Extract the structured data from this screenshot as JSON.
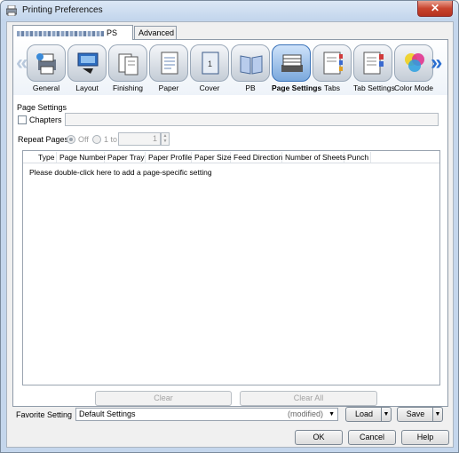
{
  "window": {
    "title": "Printing Preferences",
    "close_glyph": "✕"
  },
  "tabs": [
    {
      "label": "PS",
      "blurred_prefix": true
    },
    {
      "label": "Advanced"
    }
  ],
  "ribbon": {
    "left_arrow": "«",
    "right_arrow": "»",
    "items": [
      {
        "label": "General",
        "icon": "general-icon",
        "selected": false
      },
      {
        "label": "Layout",
        "icon": "layout-icon",
        "selected": false
      },
      {
        "label": "Finishing",
        "icon": "finishing-icon",
        "selected": false
      },
      {
        "label": "Paper",
        "icon": "paper-icon",
        "selected": false
      },
      {
        "label": "Cover",
        "icon": "cover-icon",
        "selected": false
      },
      {
        "label": "PB",
        "icon": "pb-icon",
        "selected": false
      },
      {
        "label": "Page Settings",
        "icon": "page-settings-icon",
        "selected": true
      },
      {
        "label": "Tabs",
        "icon": "tabs-icon",
        "selected": false
      },
      {
        "label": "Tab Settings",
        "icon": "tab-settings-icon",
        "selected": false
      },
      {
        "label": "Color Mode",
        "icon": "color-mode-icon",
        "selected": false
      }
    ]
  },
  "page_settings": {
    "group_label": "Page Settings",
    "chapters_label": "Chapters",
    "repeat_pages_label": "Repeat Pages",
    "off_label": "Off",
    "one_to_label": "1 to",
    "from_value": "",
    "to_value": "1"
  },
  "list": {
    "columns": [
      "Type",
      "Page Number",
      "Paper Tray",
      "Paper Profile",
      "Paper Size",
      "Feed Direction",
      "Number of Sheets",
      "Punch"
    ],
    "hint": "Please double-click here to add a page-specific setting"
  },
  "buttons": {
    "clear": "Clear",
    "clear_all": "Clear All",
    "load": "Load",
    "save": "Save",
    "ok": "OK",
    "cancel": "Cancel",
    "help": "Help"
  },
  "favorite": {
    "label": "Favorite Setting",
    "value": "Default Settings",
    "status": "(modified)"
  },
  "colors": {
    "selected_tile": "#7aa8dc",
    "arrow_active": "#2a6ed0",
    "close_button": "#c8442e"
  }
}
